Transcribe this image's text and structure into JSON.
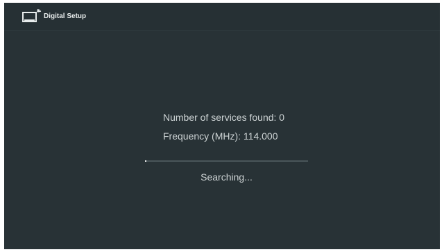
{
  "header": {
    "title": "Digital Setup",
    "icon": "tv-antenna-icon"
  },
  "scan": {
    "services_label": "Number of services found: 0",
    "frequency_label": "Frequency (MHz): 114.000",
    "progress_percent": 1,
    "status": "Searching..."
  },
  "colors": {
    "background": "#283236",
    "header_background": "#263034",
    "text": "#cdd3d4",
    "progress_fill": "#f2f4f4",
    "progress_track": "#4a565a"
  }
}
